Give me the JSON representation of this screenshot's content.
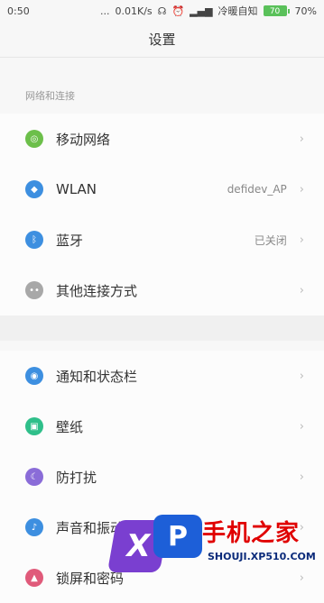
{
  "status_bar": {
    "time": "0:50",
    "dots": "...",
    "speed": "0.01K/s",
    "alarm_icon": "alarm-icon",
    "signal_icon": "signal-icon",
    "carrier": "冷暖自知",
    "battery": "70",
    "battery_pct": "70%"
  },
  "app_bar": {
    "title": "设置"
  },
  "sections": {
    "network_header": "网络和连接"
  },
  "rows": [
    {
      "id": "mobile-network",
      "label": "移动网络",
      "value": "",
      "icon": "mobile-network-icon",
      "color": "#6cbf4a",
      "glyph": "◎"
    },
    {
      "id": "wlan",
      "label": "WLAN",
      "value": "defidev_AP",
      "icon": "wifi-icon",
      "color": "#3d8fe0",
      "glyph": "◆"
    },
    {
      "id": "bluetooth",
      "label": "蓝牙",
      "value": "已关闭",
      "icon": "bluetooth-icon",
      "color": "#3d8fe0",
      "glyph": "ᛒ"
    },
    {
      "id": "other-connections",
      "label": "其他连接方式",
      "value": "",
      "icon": "more-connections-icon",
      "color": "#a8a8a8",
      "glyph": "••"
    },
    {
      "id": "notifications",
      "label": "通知和状态栏",
      "value": "",
      "icon": "notification-icon",
      "color": "#3d8fe0",
      "glyph": "◉"
    },
    {
      "id": "wallpaper",
      "label": "壁纸",
      "value": "",
      "icon": "wallpaper-icon",
      "color": "#2fbf8a",
      "glyph": "▣"
    },
    {
      "id": "dnd",
      "label": "防打扰",
      "value": "",
      "icon": "moon-icon",
      "color": "#8a6cd8",
      "glyph": "☾"
    },
    {
      "id": "sound",
      "label": "声音和振动",
      "value": "",
      "icon": "sound-icon",
      "color": "#3d8fe0",
      "glyph": "♪"
    },
    {
      "id": "lockscreen",
      "label": "锁屏和密码",
      "value": "",
      "icon": "lock-icon",
      "color": "#e05a7a",
      "glyph": "▲"
    }
  ],
  "chevron": "›",
  "watermark": {
    "logo_x": "X",
    "logo_p": "P",
    "text": "手机之家",
    "url": "SHOUJI.XP510.COM"
  }
}
